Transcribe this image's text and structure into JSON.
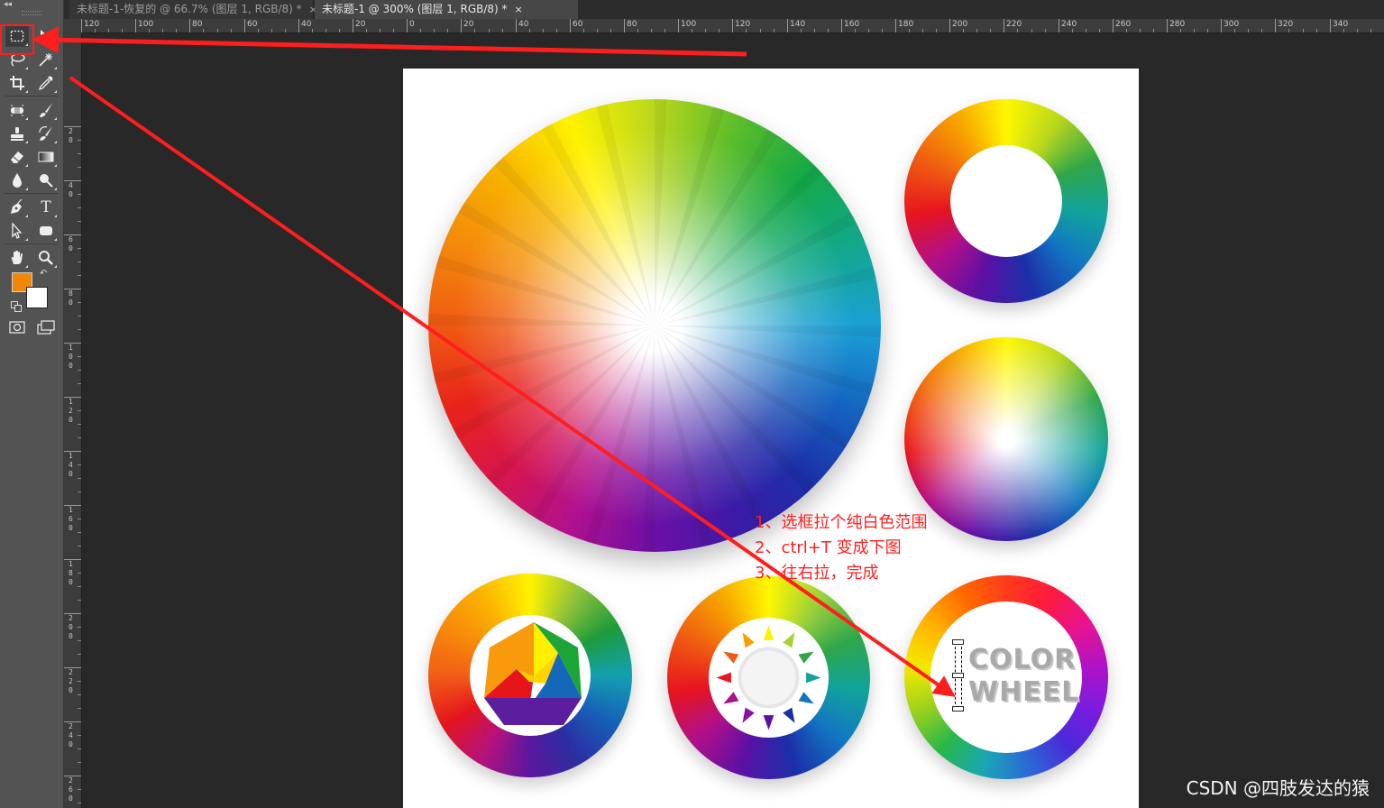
{
  "tabs": [
    {
      "label": "未标题-1-恢复的 @ 66.7% (图层 1, RGB/8) *",
      "close": "×",
      "active": false
    },
    {
      "label": "未标题-1 @ 300% (图层 1, RGB/8) *",
      "close": "×",
      "active": true
    }
  ],
  "toolbox": {
    "collapse_glyph": "◂◂",
    "tools": [
      {
        "name": "rectangular-marquee-tool",
        "icon": "dashed-rectangle",
        "active": true
      },
      {
        "name": "move-tool",
        "icon": "move-arrow"
      },
      {
        "name": "lasso-tool",
        "icon": "lasso"
      },
      {
        "name": "magic-wand-tool",
        "icon": "magic-wand"
      },
      {
        "name": "crop-tool",
        "icon": "crop"
      },
      {
        "name": "eyedropper-tool",
        "icon": "eyedropper"
      },
      {
        "name": "spot-healing-brush-tool",
        "icon": "bandage"
      },
      {
        "name": "brush-tool",
        "icon": "brush"
      },
      {
        "name": "clone-stamp-tool",
        "icon": "stamp"
      },
      {
        "name": "history-brush-tool",
        "icon": "history-brush"
      },
      {
        "name": "eraser-tool",
        "icon": "eraser"
      },
      {
        "name": "gradient-tool",
        "icon": "gradient"
      },
      {
        "name": "blur-tool",
        "icon": "drop"
      },
      {
        "name": "dodge-tool",
        "icon": "dodge"
      },
      {
        "name": "pen-tool",
        "icon": "pen"
      },
      {
        "name": "type-tool",
        "icon": "type",
        "glyph": "T"
      },
      {
        "name": "path-selection-tool",
        "icon": "path-arrow"
      },
      {
        "name": "shape-tool",
        "icon": "rounded-rectangle"
      },
      {
        "name": "hand-tool",
        "icon": "hand"
      },
      {
        "name": "zoom-tool",
        "icon": "magnifier"
      }
    ],
    "foreground_color": "#f0860a",
    "background_color": "#ffffff",
    "swap_glyph": "↶",
    "quick_mask_icon": "quick-mask",
    "screen_mode_icon": "screen-mode"
  },
  "rulers": {
    "horizontal_labels": [
      "120",
      "100",
      "80",
      "60",
      "40",
      "20",
      "0",
      "20",
      "40",
      "60",
      "80",
      "100",
      "120",
      "140",
      "160",
      "180",
      "200",
      "220",
      "240",
      "260",
      "280",
      "300",
      "320",
      "340"
    ],
    "vertical_labels": [
      "2 0",
      "4 0",
      "6 0",
      "8 0",
      "1 0 0",
      "1 2 0",
      "1 4 0",
      "1 6 0",
      "1 8 0",
      "2 0 0",
      "2 2 0",
      "2 4 0",
      "2 6 0"
    ]
  },
  "canvas": {
    "logo_line1": "COLOR",
    "logo_line2": "WHEEL",
    "colors": {
      "hex_top_left": "#f79a0c",
      "hex_top": "#fff000",
      "hex_top_right": "#1ea538",
      "hex_left_red": "#e8141c",
      "hex_center_yellow": "#ffd400",
      "hex_right_blue": "#1568b8",
      "hex_bottom": "#5a1e9e"
    }
  },
  "annotation": {
    "color": "#ff1f1f",
    "steps": [
      "1、选框拉个纯白色范围",
      "2、ctrl+T 变成下图",
      "3、往右拉，完成"
    ]
  },
  "watermark": "CSDN @四肢发达的猿"
}
